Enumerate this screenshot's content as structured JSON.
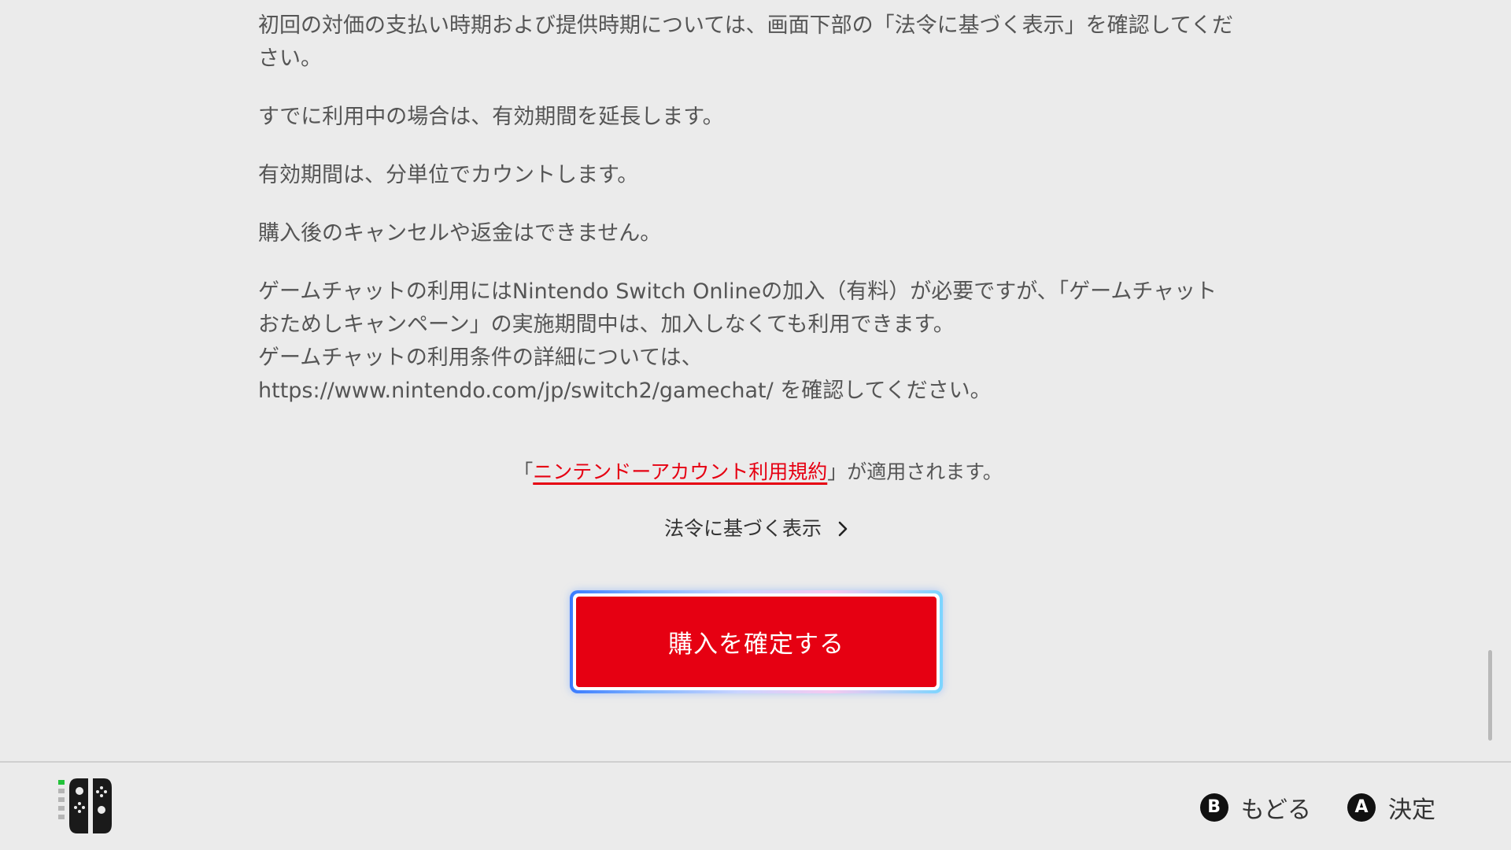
{
  "body": {
    "paragraph1": [
      "初回の対価の支払い時期および提供時期については、画面下部の「法令に基づく表示」を確認してくだ",
      "さい。"
    ],
    "paragraph2": "すでに利用中の場合は、有効期間を延長します。",
    "paragraph3": "有効期間は、分単位でカウントします。",
    "paragraph4": "購入後のキャンセルや返金はできません。",
    "paragraph5": [
      "ゲームチャットの利用にはNintendo Switch Onlineの加入（有料）が必要ですが、「ゲームチャット",
      "おためしキャンペーン」の実施期間中は、加入しなくても利用できます。",
      "ゲームチャットの利用条件の詳細については、",
      "https://www.nintendo.com/jp/switch2/gamechat/ を確認してください。"
    ]
  },
  "terms": {
    "open_bracket": "「",
    "link_label": "ニンテンドーアカウント利用規約",
    "suffix": "」が適用されます。"
  },
  "legal_link": {
    "label": "法令に基づく表示",
    "icon": "chevron-right-icon"
  },
  "confirm_button": {
    "label": "購入を確定する",
    "color": "#e60012"
  },
  "footer": {
    "controller_icon": "joy-con-icon",
    "back": {
      "key": "B",
      "label": "もどる"
    },
    "confirm": {
      "key": "A",
      "label": "決定"
    }
  }
}
